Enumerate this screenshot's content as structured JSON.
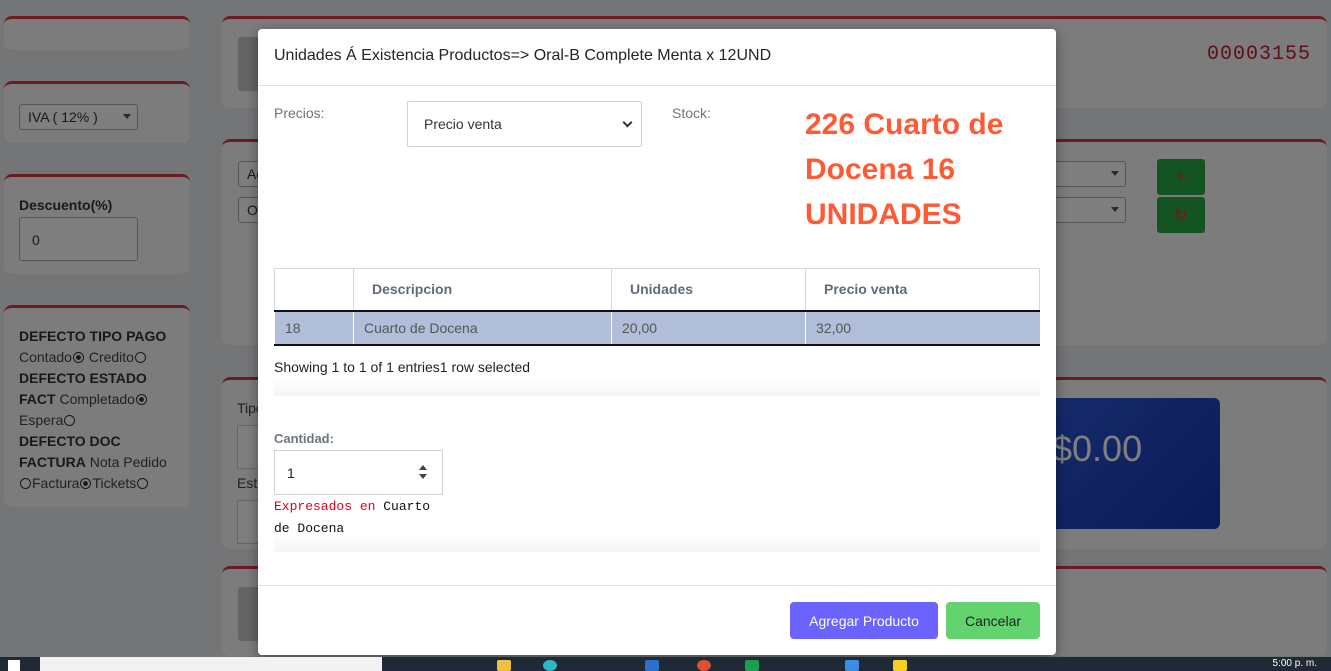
{
  "background": {
    "invoice_number": "00003155",
    "iva_select": "IVA ( 12% )",
    "discount_label": "Descuento(%)",
    "discount_value": "0",
    "defaults": {
      "tipo_pago_label": "DEFECTO TIPO PAGO",
      "contado": "Contado",
      "credito": "Credito",
      "estado_label_1": "DEFECTO ESTADO",
      "estado_label_2": "FACT",
      "completado": "Completado",
      "espera": "Espera",
      "doc_label_1": "DEFECTO DOC",
      "doc_label_2": "FACTURA",
      "nota_pedido": "Nota Pedido",
      "factura": "Factura",
      "tickets": "Tickets"
    },
    "select_a": "Ac",
    "select_o": "O",
    "tipo_label": "Tipo",
    "est_label": "Est",
    "total_amount": "$0.00",
    "add_icon": "plus-icon",
    "refresh_icon": "refresh-icon",
    "colors": {
      "accent_red": "#dc3545",
      "green": "#28a745",
      "total_blue": "#1a3fc4"
    }
  },
  "modal": {
    "title": "Unidades Á Existencia Productos=> Oral-B Complete Menta x 12UND",
    "precios_label": "Precios:",
    "precios_selected": "Precio venta",
    "stock_label": "Stock:",
    "stock_value": "226 Cuarto de Docena 16 UNIDADES",
    "table": {
      "headers": [
        "",
        "Descripcion",
        "Unidades",
        "Precio venta"
      ],
      "rows": [
        [
          "18",
          "Cuarto de Docena",
          "20,00",
          "32,00"
        ]
      ]
    },
    "showing_text": "Showing 1 to 1 of 1 entries1 row selected",
    "cantidad_label": "Cantidad:",
    "cantidad_value": "1",
    "expresados_prefix": "Expresados en",
    "expresados_unit": "Cuarto de Docena",
    "btn_agregar": "Agregar Producto",
    "btn_cancelar": "Cancelar",
    "colors": {
      "stock": "#ff5a36",
      "primary": "#6c63ff",
      "success": "#62d36e",
      "selected_row": "#b0bed9"
    }
  },
  "taskbar": {
    "clock": "5:00 p. m."
  }
}
